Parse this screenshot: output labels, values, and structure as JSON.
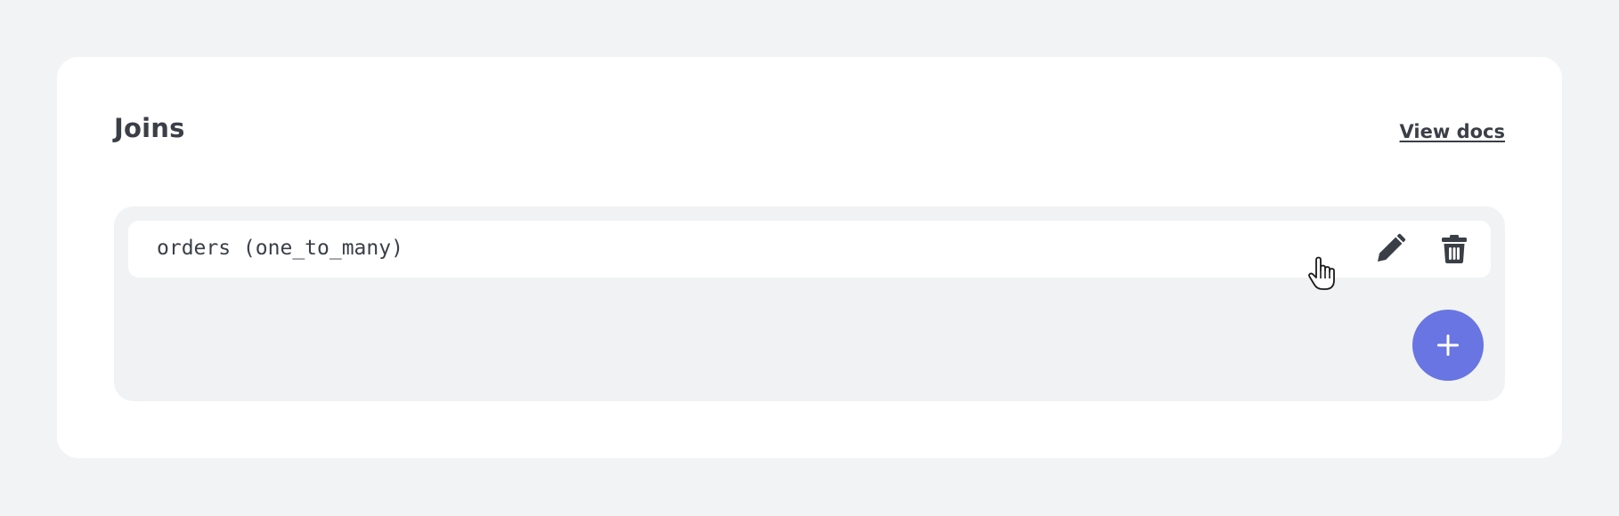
{
  "section": {
    "title": "Joins",
    "docs_link": "View docs"
  },
  "joins": {
    "items": [
      {
        "label": "orders (one_to_many)",
        "actions": [
          {
            "name": "edit",
            "icon": "pencil-icon"
          },
          {
            "name": "delete",
            "icon": "trash-icon"
          }
        ]
      }
    ],
    "add_button_icon": "plus-icon"
  },
  "colors": {
    "page_background": "#f2f3f5",
    "card_background": "#ffffff",
    "panel_background": "#f1f2f4",
    "text": "#3a3f47",
    "accent": "#6875e2"
  }
}
